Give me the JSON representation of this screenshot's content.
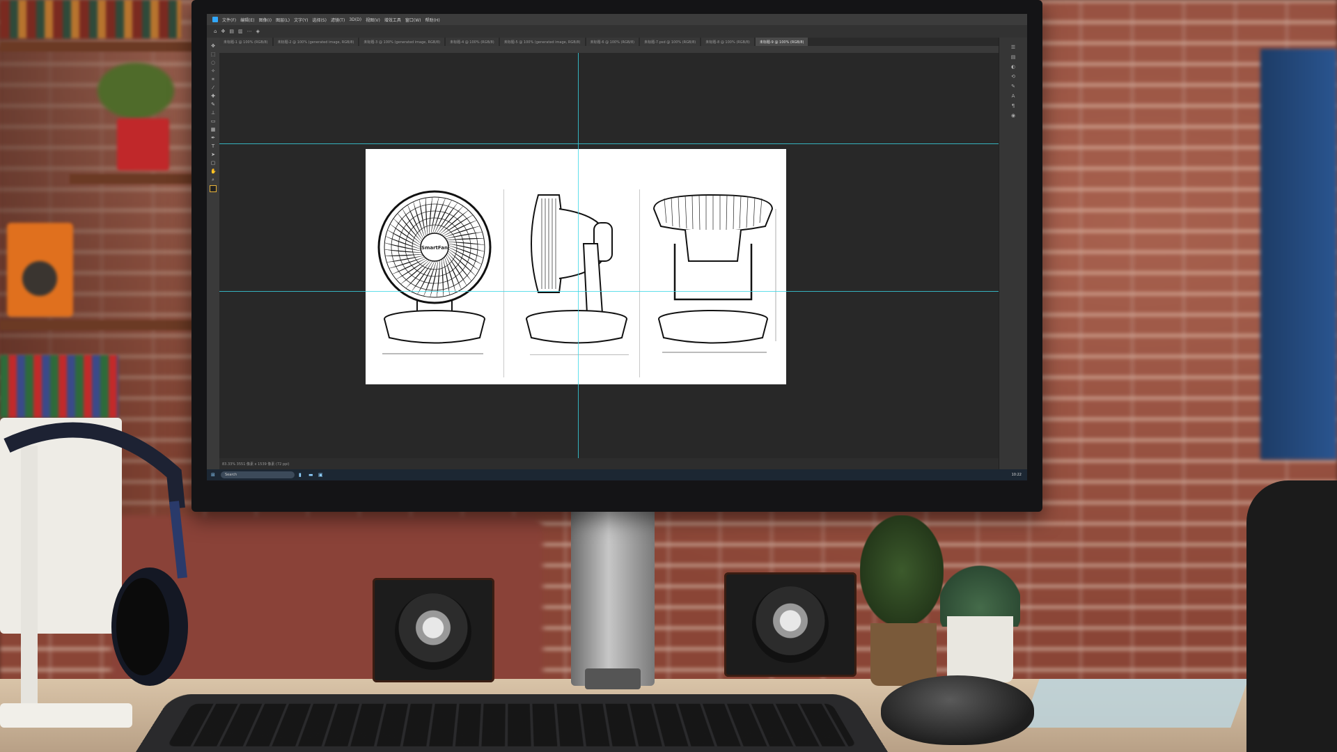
{
  "photoshop": {
    "menu": [
      "文件(F)",
      "编辑(E)",
      "图像(I)",
      "图层(L)",
      "文字(Y)",
      "选择(S)",
      "滤镜(T)",
      "3D(D)",
      "视图(V)",
      "增效工具",
      "窗口(W)",
      "帮助(H)"
    ],
    "tabs": [
      "未标题-1 @ 100% (RGB/8)",
      "未标题-2 @ 100% (generated image, RGB/8)",
      "未标题-3 @ 100% (generated image, RGB/8)",
      "未标题-4 @ 100% (RGB/8)",
      "未标题-5 @ 100% (generated image, RGB/8)",
      "未标题-6 @ 100% (RGB/8)",
      "未标题-7.psd @ 100% (RGB/8)",
      "未标题-8 @ 100% (RGB/8)",
      "未标题-9 @ 100% (RGB/8)"
    ],
    "status": "83.33%  3551 像素 x 1539 像素 (72 ppi)",
    "fan_brand": "SmartFan"
  },
  "taskbar": {
    "search_placeholder": "Search",
    "time": "10:22"
  }
}
